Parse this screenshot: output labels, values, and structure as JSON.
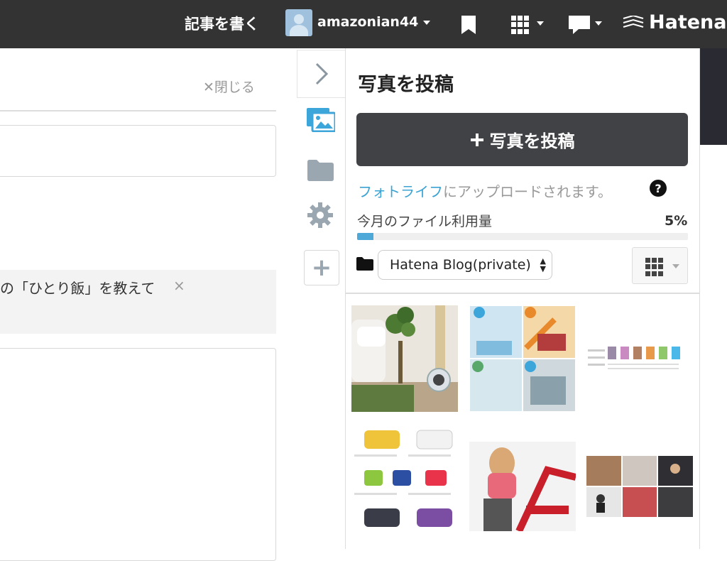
{
  "topbar": {
    "write_label": "記事を書く",
    "username": "amazonian44",
    "logo_text": "Hatena"
  },
  "editor": {
    "close_label": "✕閉じる",
    "tag_text": "の「ひとり飯」を教えて",
    "tag_remove": "×"
  },
  "rail": {
    "collapse_icon": "chevron-right-icon",
    "items": [
      "photo-icon",
      "folder-icon",
      "gear-icon",
      "plus-icon"
    ]
  },
  "photo_panel": {
    "title": "写真を投稿",
    "upload_button": "写真を投稿",
    "note_link": "フォトライフ",
    "note_rest": "にアップロードされます。",
    "help": "?",
    "usage_label": "今月のファイル利用量",
    "usage_percent_label": "5%",
    "usage_percent": 5,
    "folder_selected": "Hatena Blog(private)"
  },
  "colors": {
    "topbar": "#333333",
    "accent_link": "#3aa3d4",
    "upload_button": "#404245"
  }
}
